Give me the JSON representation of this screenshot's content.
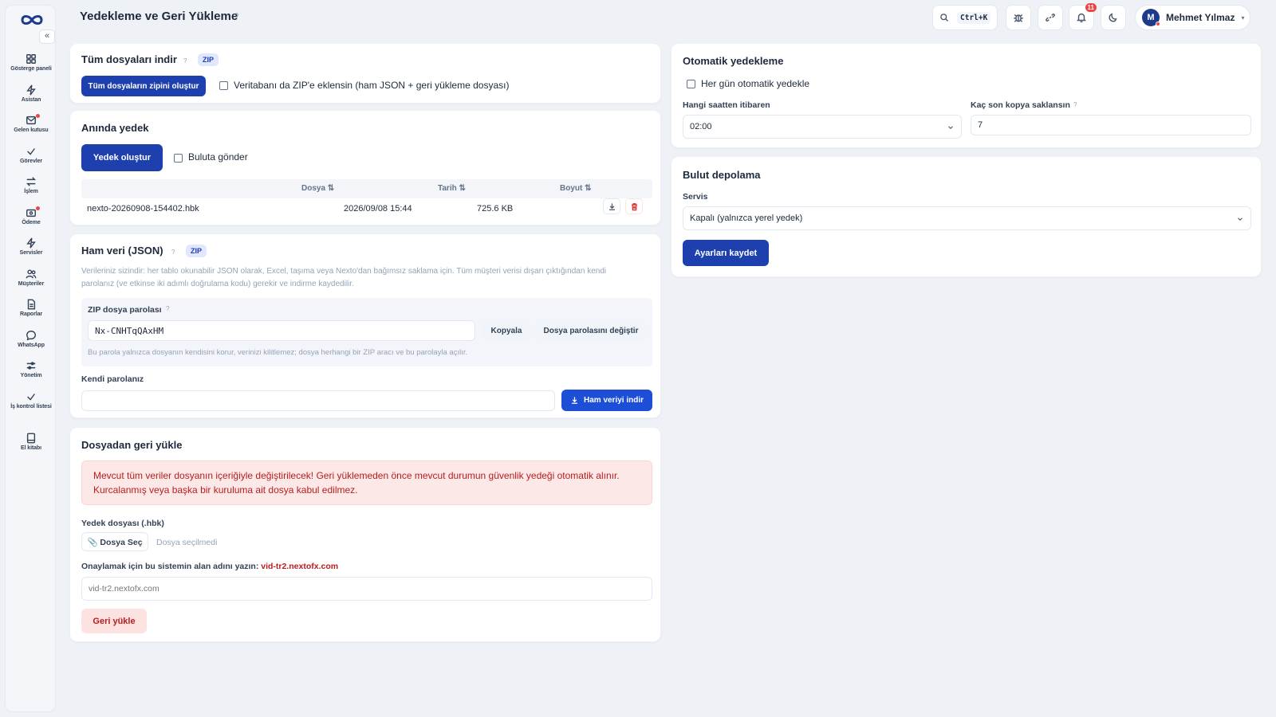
{
  "app": {
    "title": "Yedekleme ve Geri Yükleme",
    "title_help": "?"
  },
  "sidebar": {
    "collapse": "«",
    "items": [
      {
        "label": "Gösterge paneli",
        "icon": "dashboard-icon"
      },
      {
        "label": "Asistan",
        "icon": "bolt-icon"
      },
      {
        "label": "Gelen kutusu",
        "icon": "inbox-icon"
      },
      {
        "label": "Görevler",
        "icon": "check-icon"
      },
      {
        "label": "İşlem",
        "icon": "transfer-icon"
      },
      {
        "label": "Ödeme",
        "icon": "payment-icon"
      },
      {
        "label": "Servisler",
        "icon": "bolt-icon"
      },
      {
        "label": "Müşteriler",
        "icon": "users-icon"
      },
      {
        "label": "Raporlar",
        "icon": "report-icon"
      },
      {
        "label": "WhatsApp",
        "icon": "chat-icon"
      },
      {
        "label": "Yönetim",
        "icon": "sliders-icon"
      },
      {
        "label": "İş kontrol listesi",
        "icon": "check-icon"
      },
      {
        "label": "El kitabı",
        "icon": "book-icon"
      }
    ]
  },
  "topbar": {
    "search_shortcut": "Ctrl+K",
    "notifications_count": "11",
    "user": {
      "initial": "M",
      "name": "Mehmet Yılmaz",
      "caret": "▾"
    }
  },
  "download_all": {
    "title": "Tüm dosyaları indir",
    "help": "?",
    "tag": "ZIP",
    "button": "Tüm dosyaların zipini oluştur",
    "checkbox_label": "Veritabanı da ZIP'e eklensin (ham JSON + geri yükleme dosyası)"
  },
  "instant": {
    "title": "Anında yedek",
    "button": "Yedek oluştur",
    "checkbox_label": "Buluta gönder",
    "columns": [
      "Dosya ⇅",
      "Tarih ⇅",
      "Boyut ⇅"
    ],
    "rows": [
      {
        "file": "nexto-20260908-154402.hbk",
        "date": "2026/09/08 15:44",
        "size": "725.6 KB"
      }
    ]
  },
  "raw": {
    "title": "Ham veri (JSON)",
    "help": "?",
    "tag": "ZIP",
    "desc1": "Verileriniz sizindir: her tablo okunabilir JSON olarak, Excel, taşıma veya Nexto'dan bağımsız saklama için. Tüm müşteri verisi dışarı çıktığından kendi",
    "desc2": "parolanız (ve etkinse iki adımlı doğrulama kodu) gerekir ve indirme kaydedilir.",
    "zip_label": "ZIP dosya parolası",
    "zip_help": "?",
    "zip_value": "Nx-CNHTqQAxHM",
    "copy": "Kopyala",
    "change": "Dosya parolasını değiştir",
    "zip_note": "Bu parola yalnızca dosyanın kendisini korur, verinizi kilitlemez; dosya herhangi bir ZIP aracı ve bu parolayla açılır.",
    "own_label": "Kendi parolanız",
    "own_value": "",
    "download": "Ham veriyi indir"
  },
  "restore": {
    "title": "Dosyadan geri yükle",
    "alert1": "Mevcut tüm veriler dosyanın içeriğiyle değiştirilecek! Geri yüklemeden önce mevcut durumun güvenlik yedeği otomatik alınır.",
    "alert2": "Kurcalanmış veya başka bir kuruluma ait dosya kabul edilmez.",
    "file_label": "Yedek dosyası (.hbk)",
    "choose": "📎 Dosya Seç",
    "no_file": "Dosya seçilmedi",
    "confirm_prefix": "Onaylamak için bu sistemin alan adını yazın:",
    "domain": "vid-tr2.nextofx.com",
    "placeholder": "vid-tr2.nextofx.com",
    "button": "Geri yükle"
  },
  "auto": {
    "title": "Otomatik yedekleme",
    "checkbox_label": "Her gün otomatik yedekle",
    "time_label": "Hangi saatten itibaren",
    "time_value": "02:00",
    "keep_label": "Kaç son kopya saklansın",
    "keep_help": "?",
    "keep_value": "7"
  },
  "cloud": {
    "title": "Bulut depolama",
    "service_label": "Servis",
    "service_value": "Kapalı (yalnızca yerel yedek)",
    "save": "Ayarları kaydet"
  },
  "colors": {
    "primary": "#1e40af",
    "danger": "#b91c1c",
    "alert_bg": "#fde8e8",
    "bg": "#eef1f6"
  }
}
